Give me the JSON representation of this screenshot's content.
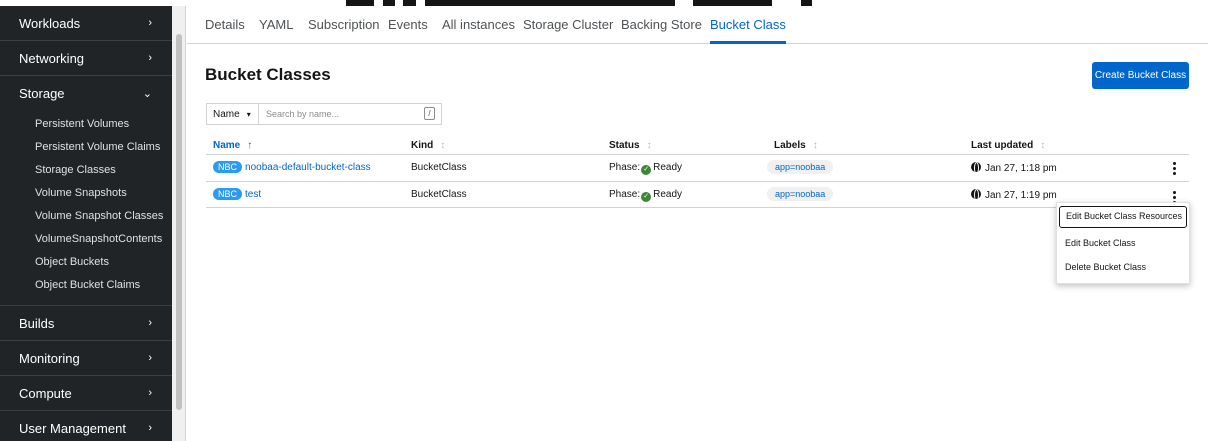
{
  "sidebar": {
    "sections_top": [
      {
        "label": "Workloads",
        "chevron": "›"
      },
      {
        "label": "Networking",
        "chevron": "›"
      }
    ],
    "storage": {
      "label": "Storage",
      "chevron": "⌄",
      "items": [
        "Persistent Volumes",
        "Persistent Volume Claims",
        "Storage Classes",
        "Volume Snapshots",
        "Volume Snapshot Classes",
        "VolumeSnapshotContents",
        "Object Buckets",
        "Object Bucket Claims"
      ]
    },
    "sections_bottom": [
      {
        "label": "Builds",
        "chevron": "›"
      },
      {
        "label": "Monitoring",
        "chevron": "›"
      },
      {
        "label": "Compute",
        "chevron": "›"
      },
      {
        "label": "User Management",
        "chevron": "›"
      }
    ]
  },
  "tabs": [
    "Details",
    "YAML",
    "Subscription",
    "Events",
    "All instances",
    "Storage Cluster",
    "Backing Store",
    "Bucket Class"
  ],
  "active_tab": "Bucket Class",
  "page": {
    "title": "Bucket Classes",
    "create_button": "Create Bucket Class"
  },
  "filter": {
    "type_label": "Name",
    "caret": "▾",
    "placeholder": "Search by name...",
    "shortcut": "/"
  },
  "table": {
    "columns": [
      "Name",
      "Kind",
      "Status",
      "Labels",
      "Last updated"
    ],
    "sort_arrow": "↑",
    "sort_inactive": "↕",
    "rows": [
      {
        "badge": "NBC",
        "name": "noobaa-default-bucket-class",
        "kind": "BucketClass",
        "status_prefix": "Phase:",
        "status": "Ready",
        "label": "app=noobaa",
        "updated": "Jan 27, 1:18 pm"
      },
      {
        "badge": "NBC",
        "name": "test",
        "kind": "BucketClass",
        "status_prefix": "Phase:",
        "status": "Ready",
        "label": "app=noobaa",
        "updated": "Jan 27, 1:19 pm"
      }
    ]
  },
  "menu": {
    "items": [
      "Edit Bucket Class Resources",
      "Edit Bucket Class",
      "Delete Bucket Class"
    ]
  },
  "colors": {
    "accent": "#0066cc",
    "sidebar_bg": "#212427",
    "ready_green": "#3e8635",
    "badge_blue": "#2b9af3"
  },
  "icons": {
    "status": "check-circle-icon",
    "updated": "globe-icon",
    "row_actions": "kebab-icon"
  }
}
